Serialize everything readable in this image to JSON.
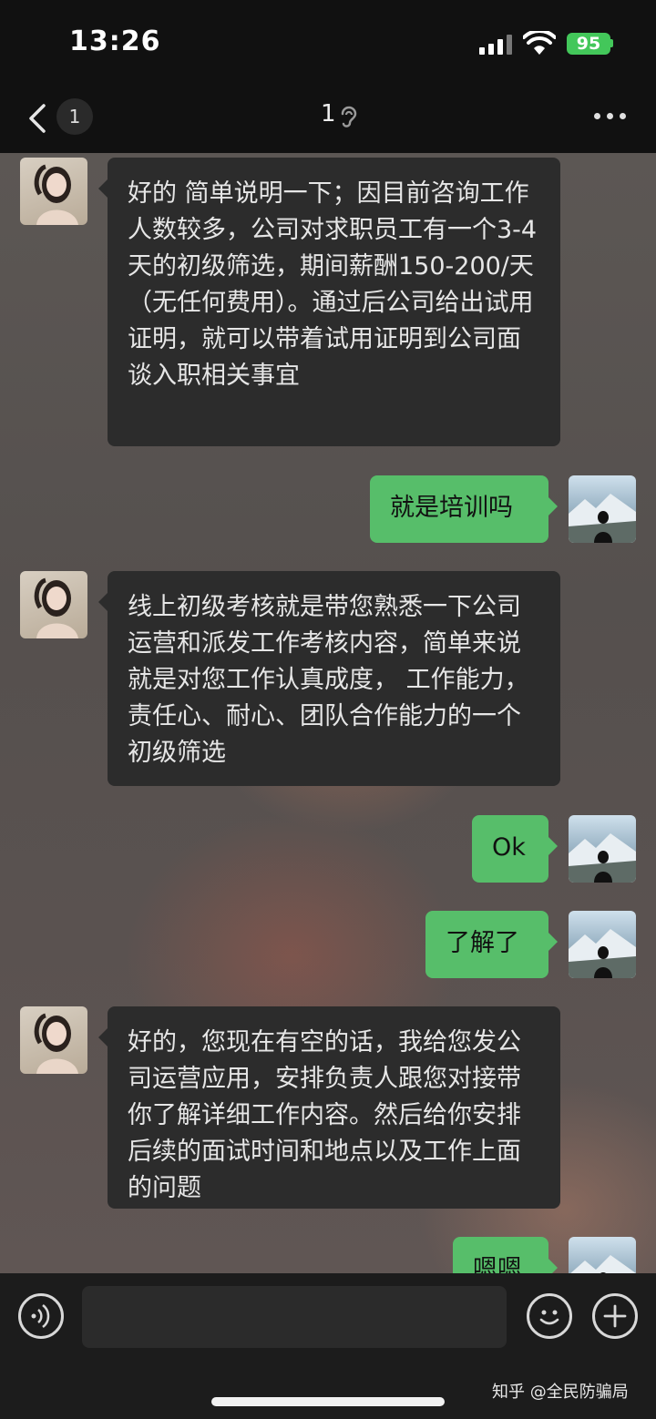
{
  "status_bar": {
    "time": "13:26",
    "battery": "95"
  },
  "nav": {
    "unread_count": "1",
    "title": "1"
  },
  "messages": [
    {
      "from": "contact",
      "text": "好的 简单说明一下；因目前咨询工作人数较多，公司对求职员工有一个3-4天的初级筛选，期间薪酬150-200/天（无任何费用）。通过后公司给出试用证明，就可以带着试用证明到公司面谈入职相关事宜"
    },
    {
      "from": "me",
      "text": "就是培训吗"
    },
    {
      "from": "contact",
      "text": "线上初级考核就是带您熟悉一下公司运营和派发工作考核内容，简单来说就是对您工作认真成度， 工作能力，责任心、耐心、团队合作能力的一个初级筛选"
    },
    {
      "from": "me",
      "text": "Ok"
    },
    {
      "from": "me",
      "text": "了解了"
    },
    {
      "from": "contact",
      "text": "好的，您现在有空的话，我给您发公司运营应用，安排负责人跟您对接带你了解详细工作内容。然后给你安排后续的面试时间和地点以及工作上面的问题"
    },
    {
      "from": "me",
      "text": "嗯嗯"
    }
  ],
  "watermark": "知乎 @全民防骗局",
  "icons": {
    "back": "chevron-left-icon",
    "ear": "ear-icon",
    "more": "more-dots-icon",
    "voice": "voice-icon",
    "emoji": "emoji-icon",
    "plus": "plus-icon"
  },
  "colors": {
    "outgoing_bubble": "#57be6a",
    "incoming_bubble": "#2c2c2c",
    "battery": "#43c75a"
  }
}
